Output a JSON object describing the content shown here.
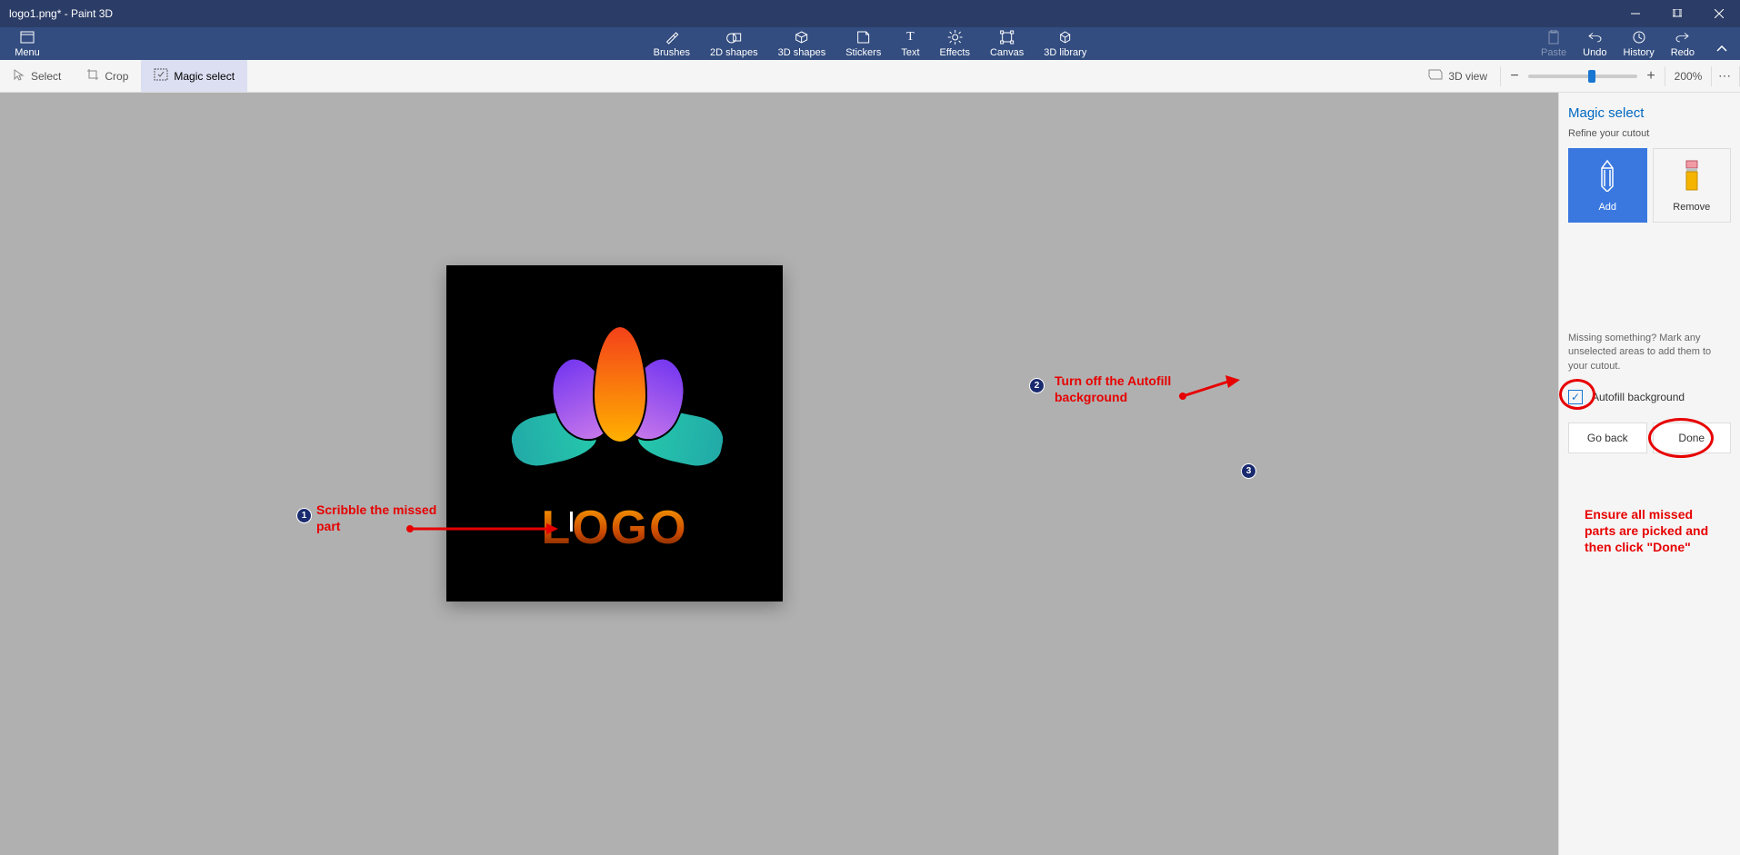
{
  "window": {
    "title": "logo1.png* - Paint 3D"
  },
  "menu": {
    "label": "Menu"
  },
  "ribbon_center": {
    "brushes": "Brushes",
    "shapes2d": "2D shapes",
    "shapes3d": "3D shapes",
    "stickers": "Stickers",
    "text": "Text",
    "effects": "Effects",
    "canvas": "Canvas",
    "library3d": "3D library"
  },
  "ribbon_right": {
    "paste": "Paste",
    "undo": "Undo",
    "history": "History",
    "redo": "Redo"
  },
  "toolbar2": {
    "select": "Select",
    "crop": "Crop",
    "magic_select": "Magic select",
    "view3d": "3D view",
    "zoom": "200%"
  },
  "canvas": {
    "logo_text": "LOGO"
  },
  "panel": {
    "title": "Magic select",
    "refine": "Refine your cutout",
    "add": "Add",
    "remove": "Remove",
    "hint": "Missing something? Mark any unselected areas to add them to your cutout.",
    "autofill": "Autofill background",
    "go_back": "Go back",
    "done": "Done"
  },
  "annotations": {
    "a1": "Scribble the missed part",
    "a2": "Turn off the Autofill background",
    "a3": "Ensure all missed parts are picked and then click \"Done\""
  }
}
